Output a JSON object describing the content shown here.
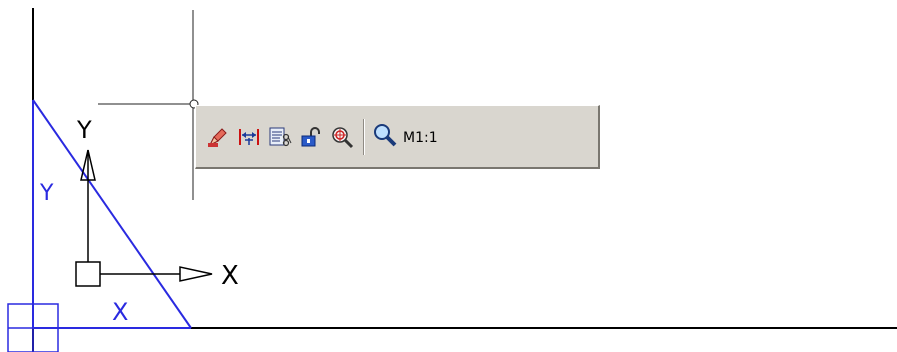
{
  "toolbar": {
    "buttons": [
      {
        "id": "edit",
        "icon": "pencil-edit-icon",
        "tooltip": ""
      },
      {
        "id": "dimension",
        "icon": "dimension-icon",
        "tooltip": ""
      },
      {
        "id": "properties",
        "icon": "properties-icon",
        "tooltip": ""
      },
      {
        "id": "lock",
        "icon": "unlock-icon",
        "tooltip": ""
      },
      {
        "id": "zoom-target",
        "icon": "zoom-target-icon",
        "tooltip": ""
      }
    ],
    "zoom": {
      "icon": "magnifier-icon",
      "label": "M1:1"
    }
  },
  "ucs": {
    "x_label": "X",
    "y_label": "Y"
  },
  "wcs": {
    "x_label": "X",
    "y_label": "Y"
  },
  "colors": {
    "wcs_blue": "#2a2ae0",
    "ucs_black": "#000000",
    "toolbar_bg": "#d9d6cf"
  }
}
